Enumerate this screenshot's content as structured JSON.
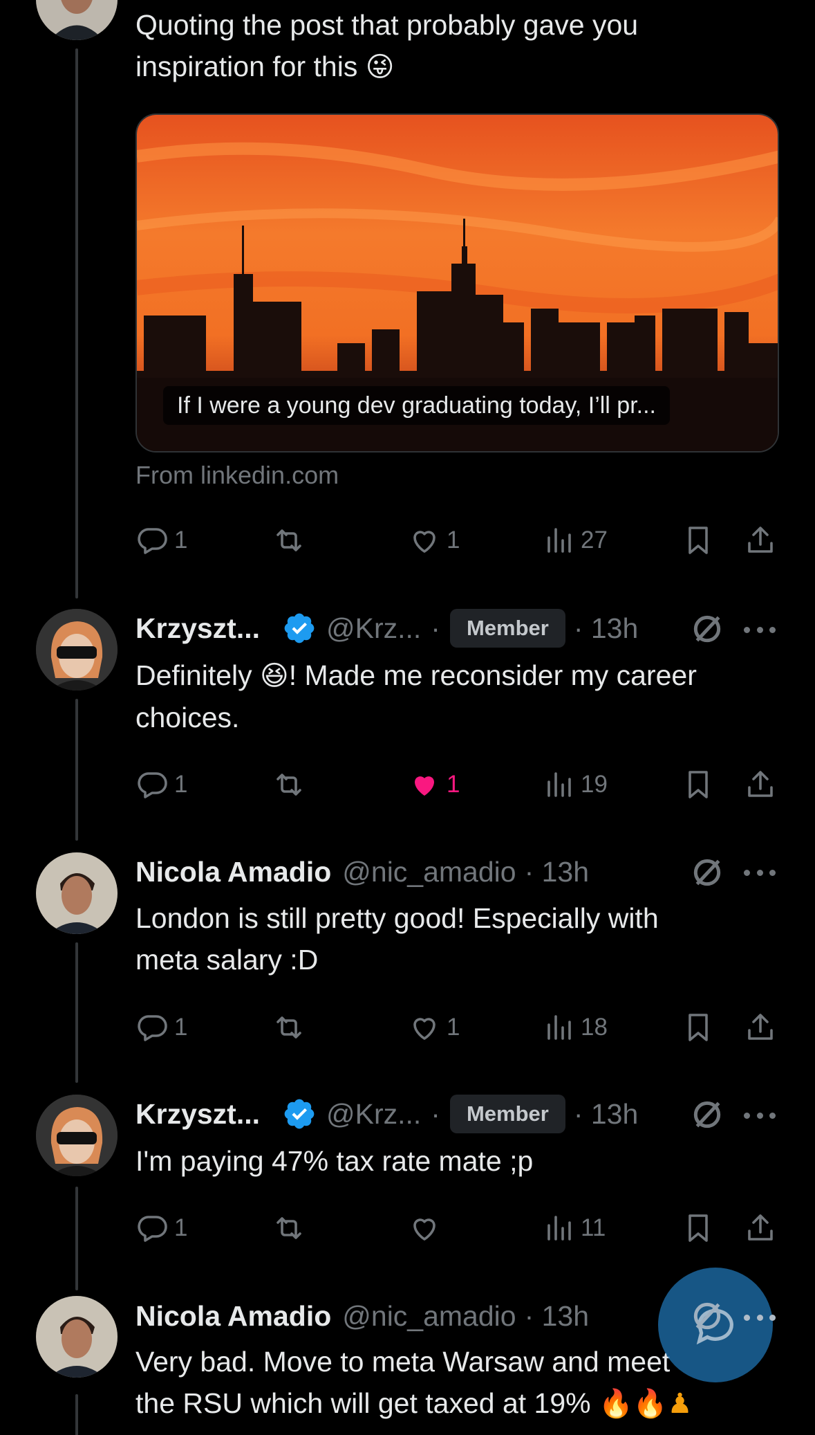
{
  "post0": {
    "text_line1": "Quoting the post that probably gave you",
    "text_line2": "inspiration for this",
    "emoji": "😜",
    "card_caption": "If I were a young dev graduating today, I’ll pr...",
    "card_source": "From linkedin.com",
    "stats": {
      "replies": "1",
      "reposts": "",
      "likes": "1",
      "views": "27"
    }
  },
  "replies": [
    {
      "name": "Krzyszt...",
      "verified": true,
      "handle": "@Krz...",
      "badge": "Member",
      "time": "· 13h",
      "text_line1": "Definitely ",
      "emoji": "😆",
      "text_line1_rest": "! Made me reconsider my career",
      "text_line2": "choices.",
      "stats": {
        "replies": "1",
        "reposts": "",
        "likes": "1",
        "liked": true,
        "views": "19"
      }
    },
    {
      "name": "Nicola Amadio",
      "handle": "@nic_amadio",
      "time": "· 13h",
      "text_line1": "London is still pretty good! Especially with",
      "text_line2": "meta salary :D",
      "stats": {
        "replies": "1",
        "reposts": "",
        "likes": "1",
        "views": "18"
      }
    },
    {
      "name": "Krzyszt...",
      "verified": true,
      "handle": "@Krz...",
      "badge": "Member",
      "time": "· 13h",
      "text_line1": "I'm paying 47% tax rate mate ;p",
      "stats": {
        "replies": "1",
        "reposts": "",
        "likes": "",
        "views": "11"
      }
    },
    {
      "name": "Nicola Amadio",
      "handle": "@nic_amadio",
      "time": "· 13h",
      "text_line1": "Very bad. Move to meta Warsaw and meet",
      "text_line2": "the RSU which will get taxed at 19% ",
      "emoji": "🔥🔥♟"
    }
  ],
  "colors": {
    "background": "#000000",
    "text": "#e7e9ea",
    "muted": "#71767b",
    "like": "#f91880",
    "verified": "#1d9bf0",
    "fab": "#1d9bf0"
  },
  "icons": [
    "reply-icon",
    "repost-icon",
    "like-icon",
    "views-icon",
    "bookmark-icon",
    "share-icon",
    "grok-icon",
    "more-icon",
    "verified-icon",
    "compose-icon"
  ]
}
